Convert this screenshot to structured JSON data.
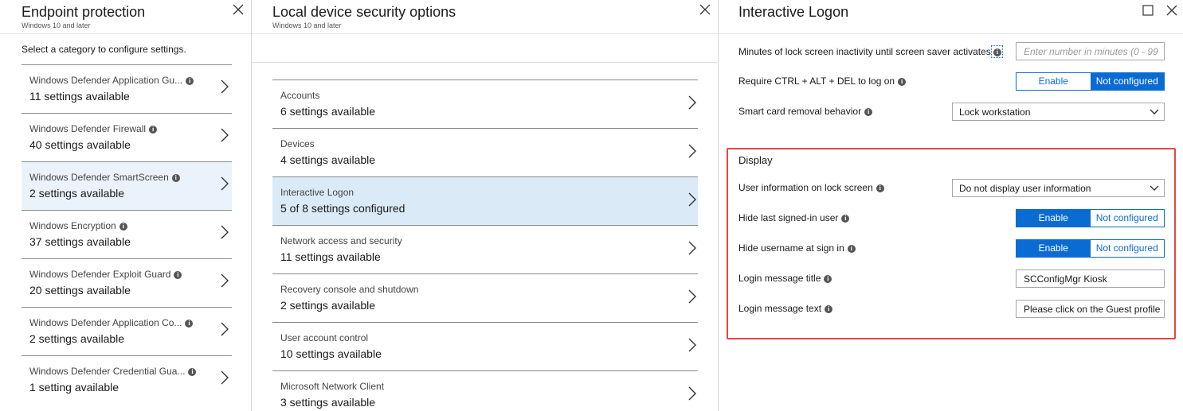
{
  "blade1": {
    "title": "Endpoint protection",
    "subtitle": "Windows 10 and later",
    "intro": "Select a category to configure settings.",
    "items": [
      {
        "name": "Windows Defender Application Gu...",
        "count": "11 settings available",
        "info": true
      },
      {
        "name": "Windows Defender Firewall",
        "count": "40 settings available",
        "info": true
      },
      {
        "name": "Windows Defender SmartScreen",
        "count": "2 settings available",
        "info": true
      },
      {
        "name": "Windows Encryption",
        "count": "37 settings available",
        "info": true
      },
      {
        "name": "Windows Defender Exploit Guard",
        "count": "20 settings available",
        "info": true
      },
      {
        "name": "Windows Defender Application Co...",
        "count": "2 settings available",
        "info": true
      },
      {
        "name": "Windows Defender Credential Gua...",
        "count": "1 setting available",
        "info": true
      }
    ],
    "selected_index": 2
  },
  "blade2": {
    "title": "Local device security options",
    "subtitle": "Windows 10 and later",
    "items": [
      {
        "name": "Accounts",
        "count": "6 settings available"
      },
      {
        "name": "Devices",
        "count": "4 settings available"
      },
      {
        "name": "Interactive Logon",
        "count": "5 of 8 settings configured"
      },
      {
        "name": "Network access and security",
        "count": "11 settings available"
      },
      {
        "name": "Recovery console and shutdown",
        "count": "2 settings available"
      },
      {
        "name": "User account control",
        "count": "10 settings available"
      },
      {
        "name": "Microsoft Network Client",
        "count": "3 settings available"
      }
    ],
    "selected_index": 2
  },
  "blade3": {
    "title": "Interactive Logon",
    "settings": {
      "screen_saver_label": "Minutes of lock screen inactivity until screen saver activates",
      "screen_saver_placeholder": "Enter number in minutes (0 - 99",
      "ctrl_alt_del_label": "Require CTRL + ALT + DEL to log on",
      "smart_card_label": "Smart card removal behavior",
      "smart_card_value": "Lock workstation"
    },
    "toggle_labels": {
      "enable": "Enable",
      "not_configured": "Not configured"
    },
    "ctrl_alt_del_state": "not_configured",
    "display": {
      "heading": "Display",
      "user_info_label": "User information on lock screen",
      "user_info_value": "Do not display user information",
      "hide_last_label": "Hide last signed-in user",
      "hide_last_state": "enable",
      "hide_username_label": "Hide username at sign in",
      "hide_username_state": "enable",
      "login_title_label": "Login message title",
      "login_title_value": "SCConfigMgr Kiosk",
      "login_text_label": "Login message text",
      "login_text_value": "Please click on the Guest profile"
    }
  },
  "colors": {
    "accent": "#0a6cd3",
    "selected_bg": "#daeaf7",
    "highlight_border": "#e5474b"
  },
  "icons": {
    "close": "close-icon",
    "maximize": "maximize-icon",
    "chevron": "chevron-right-icon",
    "info": "info-icon",
    "dropdown": "chevron-down-icon"
  }
}
